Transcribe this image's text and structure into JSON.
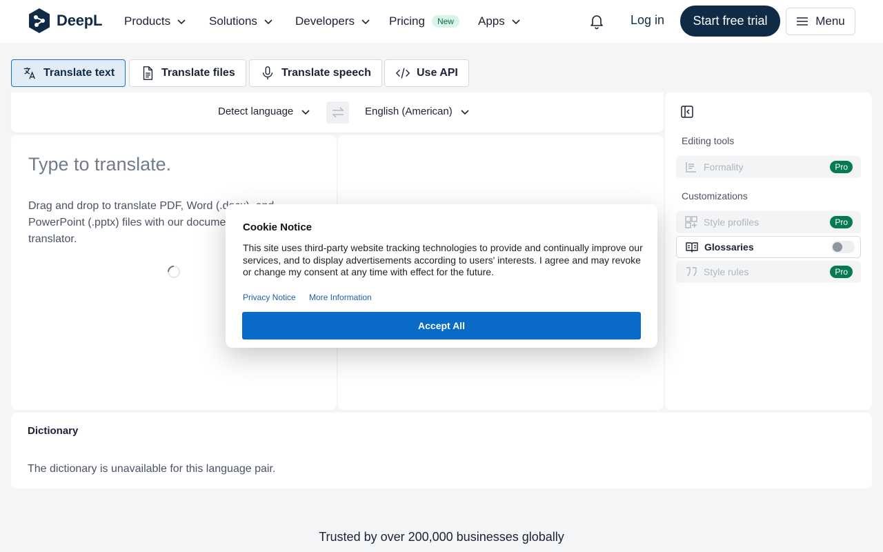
{
  "brand": {
    "name": "DeepL",
    "color": "#0f2b46"
  },
  "nav": {
    "items": [
      {
        "label": "Products",
        "has_dropdown": true
      },
      {
        "label": "Solutions",
        "has_dropdown": true
      },
      {
        "label": "Developers",
        "has_dropdown": true
      },
      {
        "label": "Pricing",
        "badge": "New",
        "has_dropdown": false
      },
      {
        "label": "Apps",
        "has_dropdown": true
      }
    ],
    "notifications_icon": "bell-icon",
    "login": "Log in",
    "cta": "Start free trial",
    "menu": "Menu"
  },
  "modes": [
    {
      "label": "Translate text",
      "icon": "translate-icon",
      "active": true
    },
    {
      "label": "Translate files",
      "icon": "file-icon",
      "active": false
    },
    {
      "label": "Translate speech",
      "icon": "microphone-icon",
      "active": false
    },
    {
      "label": "Use API",
      "icon": "code-icon",
      "active": false
    }
  ],
  "translator": {
    "source_lang": "Detect language",
    "target_lang": "English (American)",
    "placeholder": "Type to translate.",
    "hint": "Drag and drop to translate PDF, Word (.docx), and PowerPoint (.pptx) files with our document translator."
  },
  "side_panel": {
    "editing_heading": "Editing tools",
    "customizations_heading": "Customizations",
    "editing_tools": [
      {
        "label": "Formality",
        "icon": "formality-icon",
        "badge": "Pro",
        "enabled": false
      }
    ],
    "customizations": [
      {
        "label": "Style profiles",
        "icon": "style-profiles-icon",
        "badge": "Pro",
        "enabled": false
      },
      {
        "label": "Glossaries",
        "icon": "book-icon",
        "badge": "",
        "enabled": true,
        "toggle_on": false
      },
      {
        "label": "Style rules",
        "icon": "quote-icon",
        "badge": "Pro",
        "enabled": false
      }
    ]
  },
  "dictionary": {
    "title": "Dictionary",
    "message": "The dictionary is unavailable for this language pair."
  },
  "trusted": "Trusted by over 200,000 businesses globally",
  "cookie": {
    "title": "Cookie Notice",
    "body": "This site uses third-party website tracking technologies to provide and continually improve our services, and to display advertisements according to users' interests. I agree and may revoke or change my consent at any time with effect for the future.",
    "privacy_link": "Privacy Notice",
    "more_link": "More Information",
    "accept": "Accept All"
  },
  "colors": {
    "accent": "#0a6ac7",
    "active_tab_bg": "#e2ecf7",
    "pro_badge": "#067a52",
    "new_badge_bg": "#d9f5e6"
  }
}
